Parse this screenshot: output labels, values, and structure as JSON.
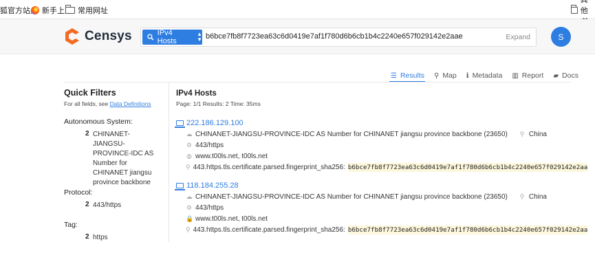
{
  "bookmarks": {
    "items": [
      {
        "label": "狐官方站点",
        "icon": "none"
      },
      {
        "label": "新手上路",
        "icon": "firefox-icon"
      },
      {
        "label": "常用网址",
        "icon": "folder-icon"
      }
    ],
    "other": {
      "label": "其他书",
      "icon": "folder-icon"
    }
  },
  "header": {
    "brand": "Censys",
    "search": {
      "scope_label": "IPv4 Hosts",
      "query": "b6bce7fb8f7723ea63c6d0419e7af1f780d6b6cb1b4c2240e657f029142e2aae",
      "expand_label": "Expand"
    },
    "avatar_initial": "S"
  },
  "tabs": [
    {
      "label": "Results",
      "icon": "list-icon",
      "active": true
    },
    {
      "label": "Map",
      "icon": "map-pin-icon",
      "active": false
    },
    {
      "label": "Metadata",
      "icon": "info-icon",
      "active": false
    },
    {
      "label": "Report",
      "icon": "bar-chart-icon",
      "active": false
    },
    {
      "label": "Docs",
      "icon": "book-icon",
      "active": false
    }
  ],
  "sidebar": {
    "title": "Quick Filters",
    "subtitle_prefix": "For all fields, see ",
    "subtitle_link": "Data Definitions",
    "facets": [
      {
        "label": "Autonomous System:",
        "items": [
          {
            "count": "2",
            "value": "CHINANET-JIANGSU-PROVINCE-IDC AS Number for CHINANET jiangsu province backbone"
          }
        ]
      },
      {
        "label": "Protocol:",
        "items": [
          {
            "count": "2",
            "value": "443/https"
          }
        ]
      },
      {
        "label": "Tag:",
        "items": [
          {
            "count": "2",
            "value": "https"
          }
        ]
      }
    ]
  },
  "results": {
    "title": "IPv4 Hosts",
    "meta": "Page: 1/1   Results: 2   Time: 35ms",
    "hits": [
      {
        "ip": "222.186.129.100",
        "as_text": "CHINANET-JIANGSU-PROVINCE-IDC AS Number for CHINANET jiangsu province backbone (23650)",
        "country": "China",
        "protocols": "443/https",
        "domains": "www.t00ls.net, t00ls.net",
        "match_field": "443.https.tls.certificate.parsed.fingerprint_sha256:",
        "match_value": "b6bce7fb8f7723ea63c6d0419e7af1f780d6b6cb1b4c2240e657f029142e2aa"
      },
      {
        "ip": "118.184.255.28",
        "as_text": "CHINANET-JIANGSU-PROVINCE-IDC AS Number for CHINANET jiangsu province backbone (23650)",
        "country": "China",
        "protocols": "443/https",
        "domains": "www.t00ls.net, t00ls.net",
        "match_field": "443.https.tls.certificate.parsed.fingerprint_sha256:",
        "match_value": "b6bce7fb8f7723ea63c6d0419e7af1f780d6b6cb1b4c2240e657f029142e2aa"
      }
    ]
  },
  "colors": {
    "accent": "#2e7de1",
    "brand_orange": "#f26b21",
    "highlight": "#fdf7dc"
  }
}
